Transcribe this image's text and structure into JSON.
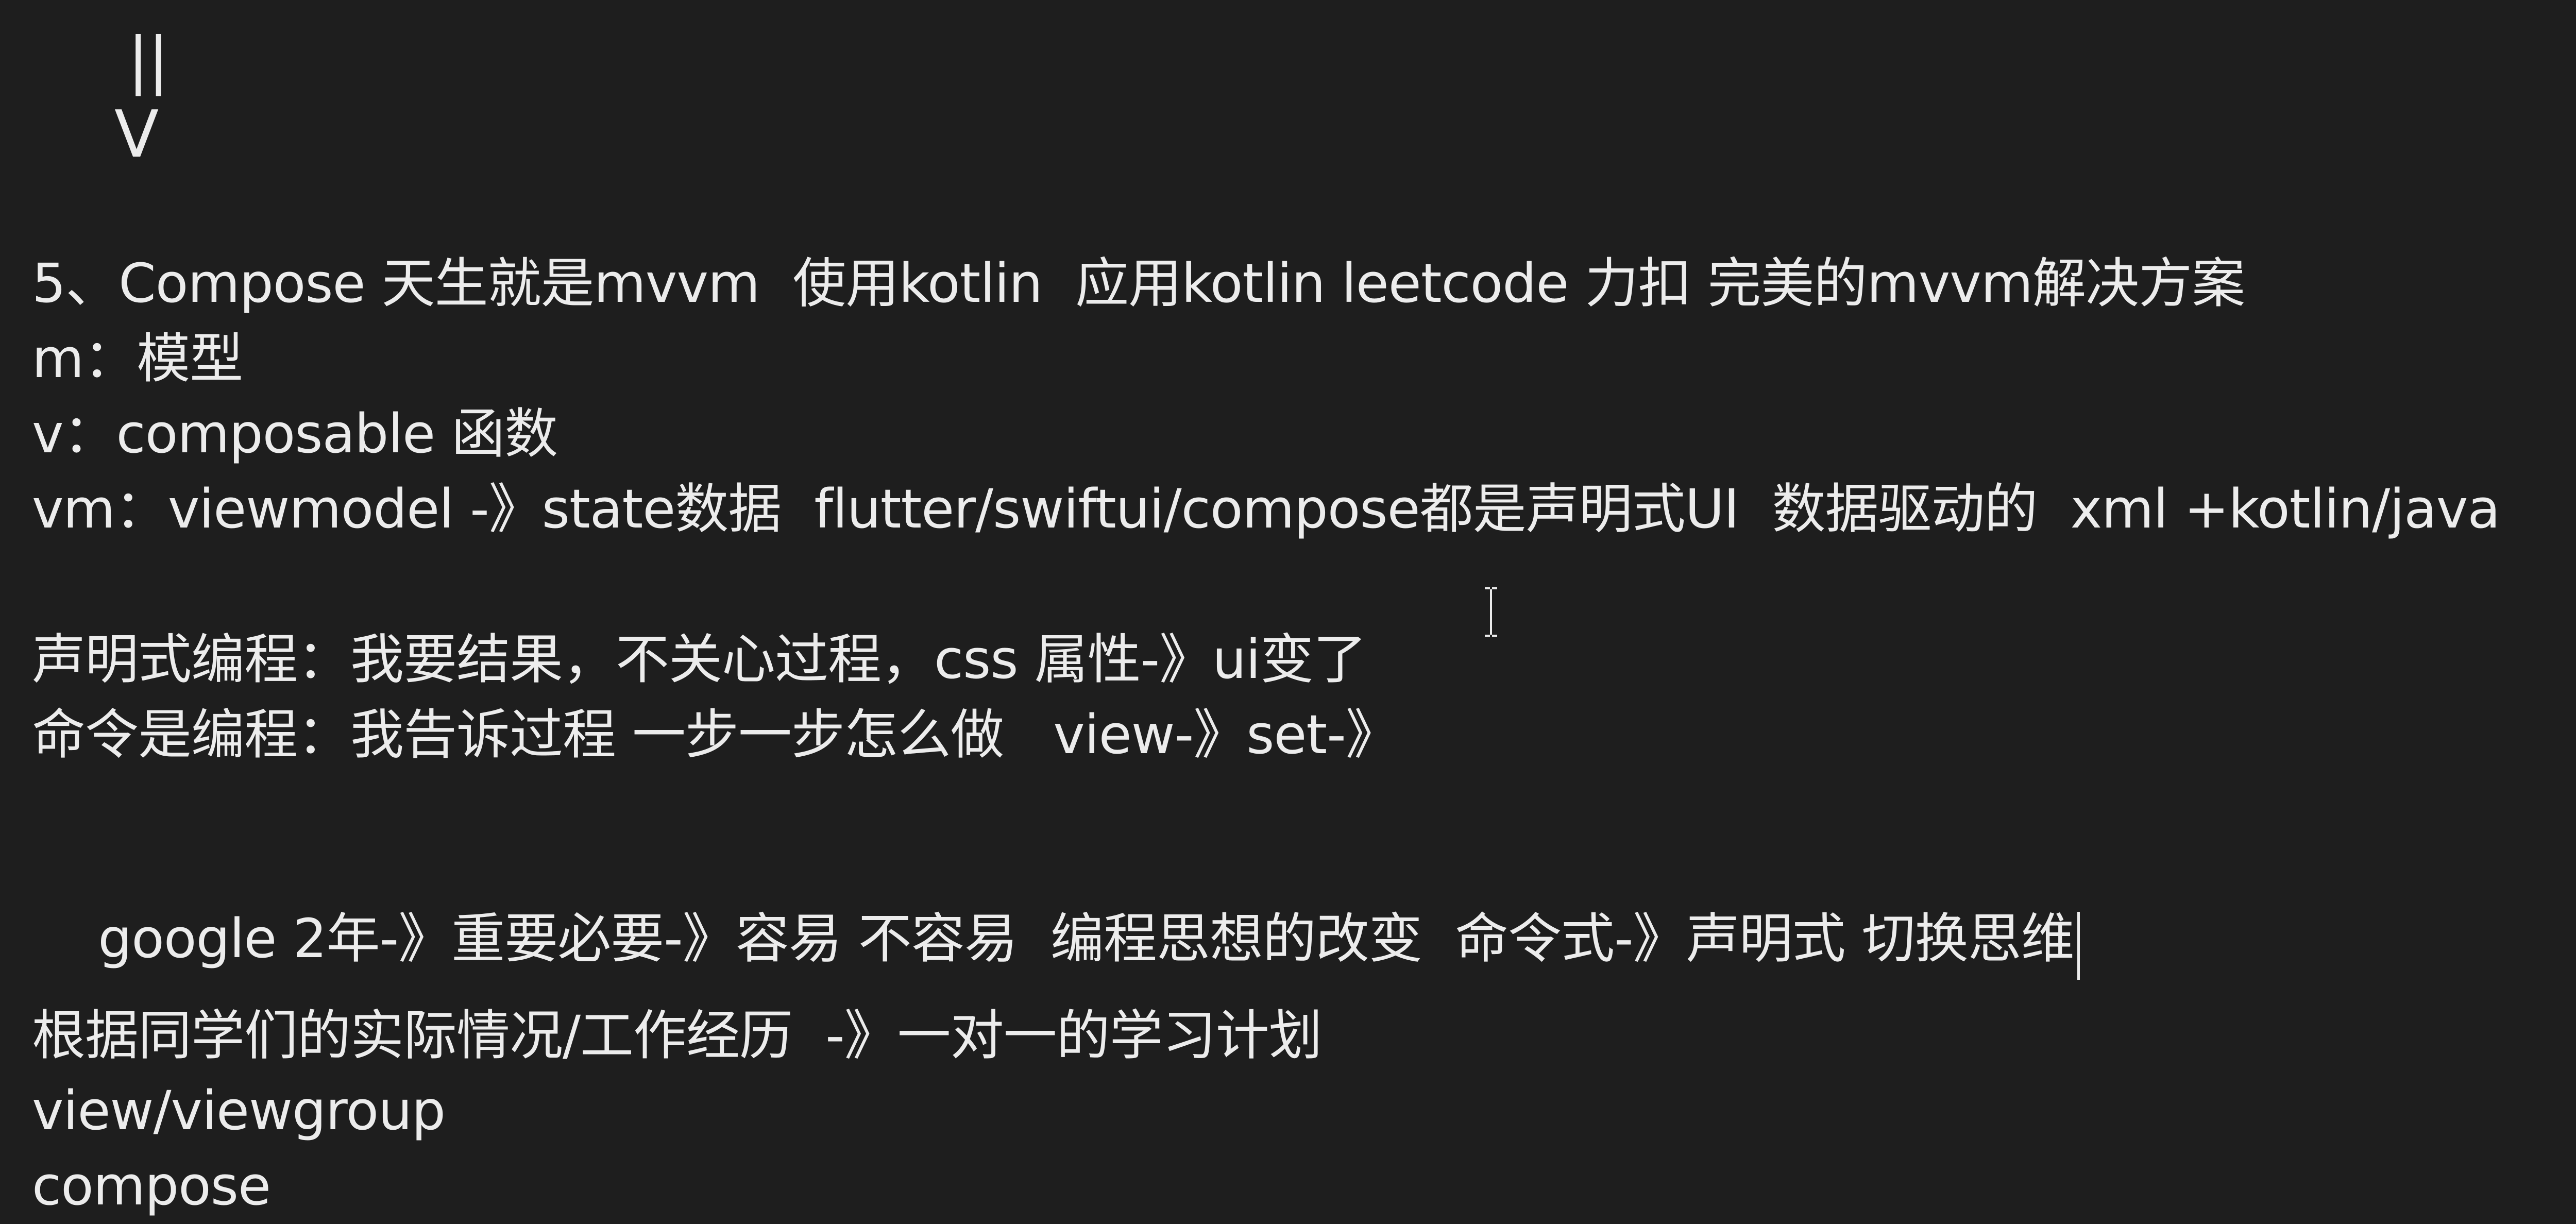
{
  "editor": {
    "lines": [
      "||",
      "V",
      "5、Compose 天生就是mvvm  使用kotlin  应用kotlin leetcode 力扣 完美的mvvm解决方案",
      "m：模型",
      "v：composable 函数",
      "vm：viewmodel -》state数据  flutter/swiftui/compose都是声明式UI  数据驱动的  xml +kotlin/java",
      "声明式编程：我要结果，不关心过程，css 属性-》ui变了",
      "命令是编程：我告诉过程 一步一步怎么做   view-》set-》",
      "google 2年-》重要必要-》容易 不容易  编程思想的改变  命令式-》声明式 切换思维",
      "根据同学们的实际情况/工作经历  -》一对一的学习计划",
      "view/viewgroup",
      "compose"
    ]
  },
  "colors": {
    "background": "#1e1e1e",
    "text": "#ececec"
  },
  "icons": {
    "cursor": "text-cursor-ibeam-icon",
    "caret": "text-caret-icon"
  }
}
